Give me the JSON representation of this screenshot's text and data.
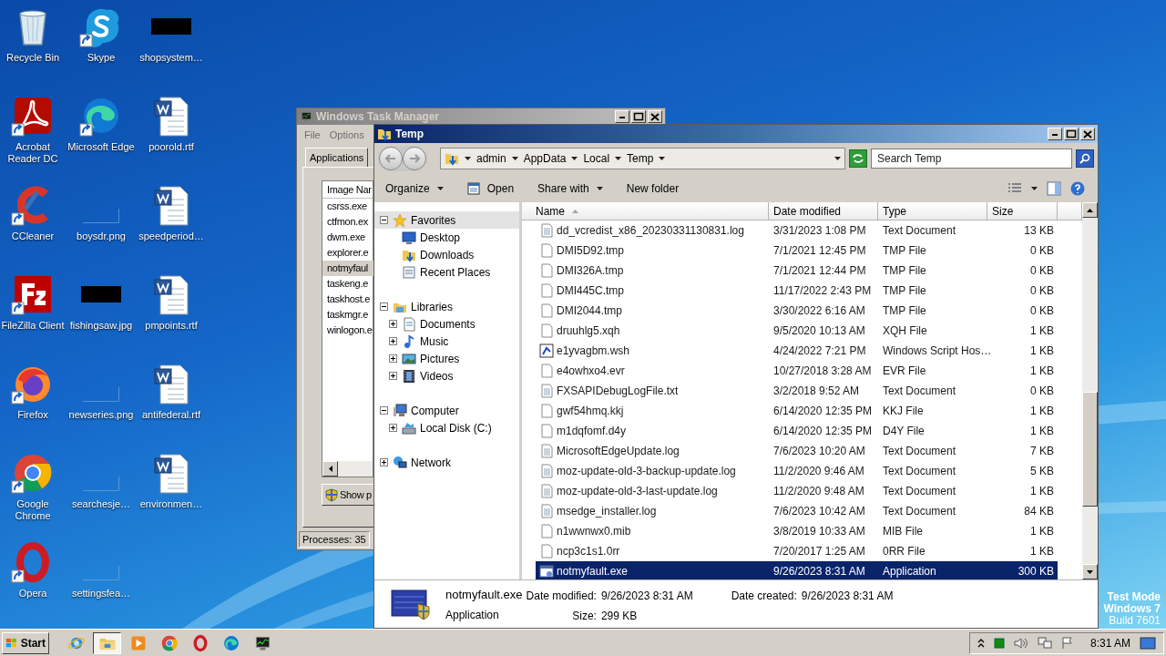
{
  "desktop": {
    "icons": [
      {
        "label": "Recycle Bin",
        "kind": "recycle",
        "shortcut": false
      },
      {
        "label": "Acrobat Reader DC",
        "kind": "acrobat",
        "shortcut": true
      },
      {
        "label": "CCleaner",
        "kind": "ccleaner",
        "shortcut": true
      },
      {
        "label": "FileZilla Client",
        "kind": "filezilla",
        "shortcut": true
      },
      {
        "label": "Firefox",
        "kind": "firefox",
        "shortcut": true
      },
      {
        "label": "Google Chrome",
        "kind": "chrome",
        "shortcut": true
      },
      {
        "label": "Opera",
        "kind": "opera",
        "shortcut": true
      },
      {
        "label": "Skype",
        "kind": "skype",
        "shortcut": true
      },
      {
        "label": "Microsoft Edge",
        "kind": "edge",
        "shortcut": true
      },
      {
        "label": "boysdr.png",
        "kind": "thumb-blank"
      },
      {
        "label": "fishingsaw.jpg",
        "kind": "thumb-dark"
      },
      {
        "label": "newseries.png",
        "kind": "thumb-blank"
      },
      {
        "label": "searchesje…",
        "kind": "thumb-blank"
      },
      {
        "label": "settingsfea…",
        "kind": "thumb-blank"
      },
      {
        "label": "shopsystem…",
        "kind": "thumb-dark"
      },
      {
        "label": "poorold.rtf",
        "kind": "word",
        "shortcut": false
      },
      {
        "label": "speedperiod…",
        "kind": "word",
        "shortcut": false
      },
      {
        "label": "pmpoints.rtf",
        "kind": "word",
        "shortcut": false
      },
      {
        "label": "antifederal.rtf",
        "kind": "word",
        "shortcut": false
      },
      {
        "label": "environmen…",
        "kind": "word",
        "shortcut": false
      }
    ]
  },
  "task_manager": {
    "title": "Windows Task Manager",
    "menu": [
      "File",
      "Options"
    ],
    "tabs": [
      {
        "label": "Applications",
        "selected": false
      }
    ],
    "column": "Image Nar",
    "processes": [
      {
        "name": "csrss.exe",
        "selected": false
      },
      {
        "name": "ctfmon.ex",
        "selected": false
      },
      {
        "name": "dwm.exe",
        "selected": false
      },
      {
        "name": "explorer.e",
        "selected": false
      },
      {
        "name": "notmyfaul",
        "selected": true
      },
      {
        "name": "taskeng.e",
        "selected": false
      },
      {
        "name": "taskhost.e",
        "selected": false
      },
      {
        "name": "taskmgr.e",
        "selected": false
      },
      {
        "name": "winlogon.e",
        "selected": false
      }
    ],
    "button": "Show p",
    "status": "Processes: 35"
  },
  "explorer": {
    "title": "Temp",
    "breadcrumb": [
      "admin",
      "AppData",
      "Local",
      "Temp"
    ],
    "search": {
      "placeholder": "Search Temp"
    },
    "toolbar": [
      {
        "label": "Organize",
        "kind": "menu"
      },
      {
        "label": "Open",
        "kind": "open"
      },
      {
        "label": "Share with",
        "kind": "menu"
      },
      {
        "label": "New folder",
        "kind": "plain"
      }
    ],
    "nav": [
      {
        "label": "Favorites",
        "kind": "star",
        "expanded": true,
        "selected": true,
        "children": [
          {
            "label": "Desktop",
            "kind": "desktop",
            "selected": false
          },
          {
            "label": "Downloads",
            "kind": "downloads",
            "selected": false
          },
          {
            "label": "Recent Places",
            "kind": "recent",
            "selected": false
          }
        ]
      },
      {
        "label": "Libraries",
        "kind": "library",
        "expanded": true,
        "selected": false,
        "children": [
          {
            "label": "Documents",
            "kind": "documents",
            "expanded": false,
            "selected": false
          },
          {
            "label": "Music",
            "kind": "music",
            "expanded": false,
            "selected": false
          },
          {
            "label": "Pictures",
            "kind": "pictures",
            "expanded": false,
            "selected": false
          },
          {
            "label": "Videos",
            "kind": "videos",
            "expanded": false,
            "selected": false
          }
        ]
      },
      {
        "label": "Computer",
        "kind": "computer",
        "expanded": true,
        "selected": false,
        "children": [
          {
            "label": "Local Disk (C:)",
            "kind": "disk",
            "expanded": false,
            "selected": false
          }
        ]
      },
      {
        "label": "Network",
        "kind": "network",
        "expanded": false,
        "selected": false
      }
    ],
    "columns": [
      {
        "label": "Name",
        "sorted": true
      },
      {
        "label": "Date modified",
        "sorted": false
      },
      {
        "label": "Type",
        "sorted": false
      },
      {
        "label": "Size",
        "sorted": false
      }
    ],
    "files": [
      {
        "name": "dd_vcredist_x86_20230331130831.log",
        "date": "3/31/2023 1:08 PM",
        "type": "Text Document",
        "size": "13 KB",
        "kind": "text",
        "selected": false
      },
      {
        "name": "DMI5D92.tmp",
        "date": "7/1/2021 12:45 PM",
        "type": "TMP File",
        "size": "0 KB",
        "kind": "blank",
        "selected": false
      },
      {
        "name": "DMI326A.tmp",
        "date": "7/1/2021 12:44 PM",
        "type": "TMP File",
        "size": "0 KB",
        "kind": "blank",
        "selected": false
      },
      {
        "name": "DMI445C.tmp",
        "date": "11/17/2022 2:43 PM",
        "type": "TMP File",
        "size": "0 KB",
        "kind": "blank",
        "selected": false
      },
      {
        "name": "DMI2044.tmp",
        "date": "3/30/2022 6:16 AM",
        "type": "TMP File",
        "size": "0 KB",
        "kind": "blank",
        "selected": false
      },
      {
        "name": "druuhlg5.xqh",
        "date": "9/5/2020 10:13 AM",
        "type": "XQH File",
        "size": "1 KB",
        "kind": "blank",
        "selected": false
      },
      {
        "name": "e1yvagbm.wsh",
        "date": "4/24/2022 7:21 PM",
        "type": "Windows Script Hos…",
        "size": "1 KB",
        "kind": "script",
        "selected": false
      },
      {
        "name": "e4owhxo4.evr",
        "date": "10/27/2018 3:28 AM",
        "type": "EVR File",
        "size": "1 KB",
        "kind": "blank",
        "selected": false
      },
      {
        "name": "FXSAPIDebugLogFile.txt",
        "date": "3/2/2018 9:52 AM",
        "type": "Text Document",
        "size": "0 KB",
        "kind": "text",
        "selected": false
      },
      {
        "name": "gwf54hmq.kkj",
        "date": "6/14/2020 12:35 PM",
        "type": "KKJ File",
        "size": "1 KB",
        "kind": "blank",
        "selected": false
      },
      {
        "name": "m1dqfomf.d4y",
        "date": "6/14/2020 12:35 PM",
        "type": "D4Y File",
        "size": "1 KB",
        "kind": "blank",
        "selected": false
      },
      {
        "name": "MicrosoftEdgeUpdate.log",
        "date": "7/6/2023 10:20 AM",
        "type": "Text Document",
        "size": "7 KB",
        "kind": "text",
        "selected": false
      },
      {
        "name": "moz-update-old-3-backup-update.log",
        "date": "11/2/2020 9:46 AM",
        "type": "Text Document",
        "size": "5 KB",
        "kind": "text",
        "selected": false
      },
      {
        "name": "moz-update-old-3-last-update.log",
        "date": "11/2/2020 9:48 AM",
        "type": "Text Document",
        "size": "1 KB",
        "kind": "text",
        "selected": false
      },
      {
        "name": "msedge_installer.log",
        "date": "7/6/2023 10:42 AM",
        "type": "Text Document",
        "size": "84 KB",
        "kind": "text",
        "selected": false
      },
      {
        "name": "n1wwnwx0.mib",
        "date": "3/8/2019 10:33 AM",
        "type": "MIB File",
        "size": "1 KB",
        "kind": "blank",
        "selected": false
      },
      {
        "name": "ncp3c1s1.0rr",
        "date": "7/20/2017 1:25 AM",
        "type": "0RR File",
        "size": "1 KB",
        "kind": "blank",
        "selected": false
      },
      {
        "name": "notmyfault.exe",
        "date": "9/26/2023 8:31 AM",
        "type": "Application",
        "size": "300 KB",
        "kind": "app",
        "selected": true
      }
    ],
    "details": {
      "name": "notmyfault.exe",
      "type": "Application",
      "fields": [
        {
          "label": "Date modified:",
          "value": "9/26/2023 8:31 AM"
        },
        {
          "label": "Size:",
          "value": "299 KB"
        },
        {
          "label": "Date created:",
          "value": "9/26/2023 8:31 AM"
        }
      ]
    }
  },
  "test_mode": [
    "Test Mode",
    "Windows 7",
    "Build 7601"
  ],
  "taskbar": {
    "start": "Start",
    "apps": [
      {
        "kind": "ie",
        "active": false
      },
      {
        "kind": "explorer",
        "active": true
      },
      {
        "kind": "media",
        "active": false
      },
      {
        "kind": "chrome",
        "active": false
      },
      {
        "kind": "opera",
        "active": false
      },
      {
        "kind": "edge",
        "active": false
      },
      {
        "kind": "taskmgr",
        "active": false
      }
    ],
    "clock": "8:31 AM"
  }
}
